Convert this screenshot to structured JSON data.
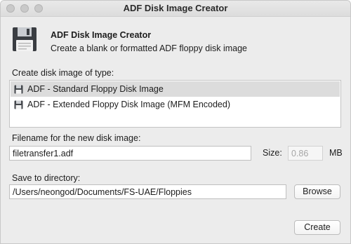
{
  "window": {
    "title": "ADF Disk Image Creator"
  },
  "header": {
    "title": "ADF Disk Image Creator",
    "subtitle": "Create a blank or formatted ADF floppy disk image",
    "icon": "floppy-disk-icon"
  },
  "disk_type": {
    "label": "Create disk image of type:",
    "items": [
      {
        "label": "ADF - Standard Floppy Disk Image",
        "selected": true,
        "icon": "floppy-disk-icon"
      },
      {
        "label": "ADF - Extended Floppy Disk Image (MFM Encoded)",
        "selected": false,
        "icon": "floppy-disk-icon"
      }
    ]
  },
  "filename": {
    "label": "Filename for the new disk image:",
    "value": "filetransfer1.adf"
  },
  "size": {
    "label": "Size:",
    "value": "0.86",
    "unit": "MB"
  },
  "directory": {
    "label": "Save to directory:",
    "value": "/Users/neongod/Documents/FS-UAE/Floppies",
    "browse_label": "Browse"
  },
  "actions": {
    "create_label": "Create"
  },
  "colors": {
    "selection": "#dcdcdc",
    "window_bg": "#ececec"
  }
}
